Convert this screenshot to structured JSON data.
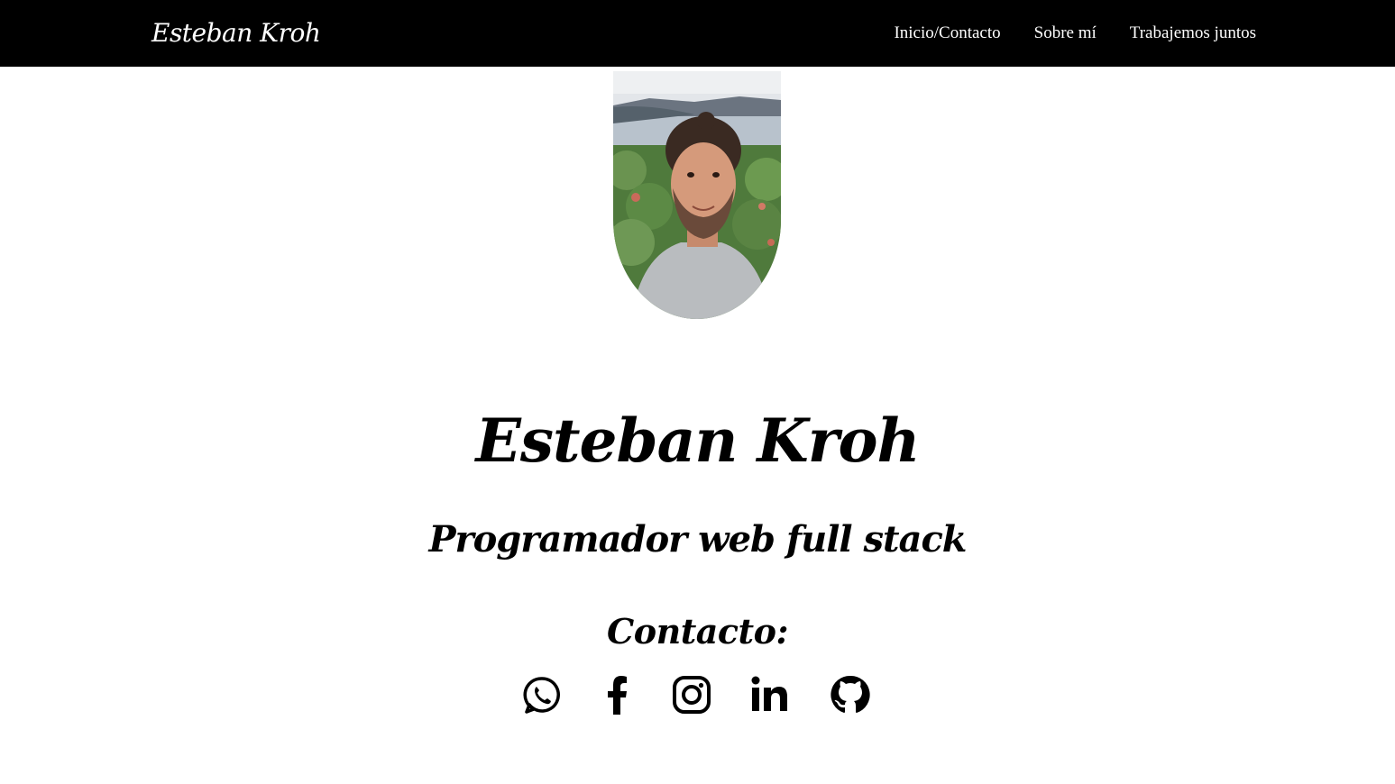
{
  "navbar": {
    "brand": "Esteban Kroh",
    "links": [
      "Inicio/Contacto",
      "Sobre mí",
      "Trabajemos juntos"
    ]
  },
  "hero": {
    "name": "Esteban Kroh",
    "role": "Programador web full stack",
    "contact_label": "Contacto:"
  },
  "social_icons": [
    "whatsapp-icon",
    "facebook-icon",
    "instagram-icon",
    "linkedin-icon",
    "github-icon"
  ],
  "colors": {
    "navbar_bg": "#000000",
    "navbar_text": "#ffffff",
    "page_bg": "#ffffff",
    "text": "#000000"
  }
}
